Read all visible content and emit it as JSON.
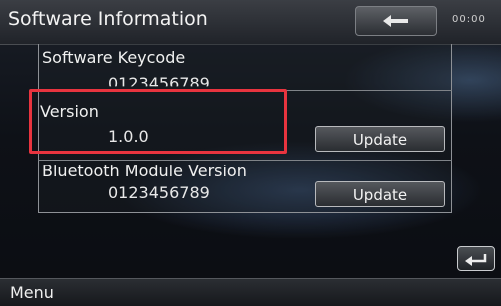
{
  "header": {
    "title": "Software Information",
    "clock": "00:00",
    "back_icon": "arrow-left-icon"
  },
  "items": [
    {
      "label": "Software Keycode",
      "value": "0123456789"
    },
    {
      "label": "Version",
      "value": "1.0.0",
      "button": "Update"
    },
    {
      "label": "Bluetooth Module Version",
      "value": "0123456789",
      "button": "Update"
    }
  ],
  "footer": {
    "menu_label": "Menu",
    "return_icon": "return-icon"
  },
  "colors": {
    "highlight": "#e8343f",
    "background": "#0e1117"
  }
}
